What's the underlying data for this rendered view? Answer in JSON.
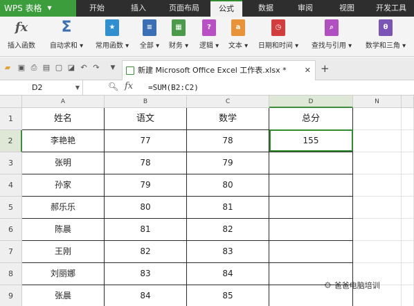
{
  "app": {
    "name": "WPS 表格"
  },
  "menu": {
    "tabs": [
      "开始",
      "插入",
      "页面布局",
      "公式",
      "数据",
      "审阅",
      "视图",
      "开发工具"
    ],
    "active_index": 3
  },
  "ribbon": {
    "buttons": [
      {
        "label": "插入函数",
        "icon": "fx-icon"
      },
      {
        "label": "自动求和",
        "icon": "sigma-icon"
      },
      {
        "label": "常用函数",
        "icon": "star-icon"
      },
      {
        "label": "全部",
        "icon": "list-icon"
      },
      {
        "label": "财务",
        "icon": "finance-icon"
      },
      {
        "label": "逻辑",
        "icon": "logic-icon"
      },
      {
        "label": "文本",
        "icon": "text-icon"
      },
      {
        "label": "日期和时间",
        "icon": "clock-icon"
      },
      {
        "label": "查找与引用",
        "icon": "search-icon"
      },
      {
        "label": "数学和三角",
        "icon": "theta-icon"
      }
    ],
    "colors": {
      "star": "#2f8fcf",
      "list": "#3a6fb5",
      "finance": "#4a9a4a",
      "logic": "#b84fc4",
      "text": "#e8923a",
      "clock": "#d23c3c",
      "search": "#b04fbf",
      "theta": "#7a55b5"
    }
  },
  "document": {
    "tab_title": "新建 Microsoft Office Excel 工作表.xlsx *"
  },
  "formula_bar": {
    "cell_ref": "D2",
    "formula": "=SUM(B2:C2)"
  },
  "sheet": {
    "columns": [
      "A",
      "B",
      "C",
      "D",
      "N"
    ],
    "selected_column": "D",
    "row_numbers": [
      "1",
      "2",
      "3",
      "4",
      "5",
      "6",
      "7",
      "8",
      "9"
    ],
    "selected_row": "2",
    "header": [
      "姓名",
      "语文",
      "数学",
      "总分"
    ],
    "rows": [
      [
        "李艳艳",
        "77",
        "78",
        "155"
      ],
      [
        "张明",
        "78",
        "79",
        ""
      ],
      [
        "孙家",
        "79",
        "80",
        ""
      ],
      [
        "郝乐乐",
        "80",
        "81",
        ""
      ],
      [
        "陈晨",
        "81",
        "82",
        ""
      ],
      [
        "王刚",
        "82",
        "83",
        ""
      ],
      [
        "刘丽娜",
        "83",
        "84",
        ""
      ],
      [
        "张晨",
        "84",
        "85",
        ""
      ]
    ]
  },
  "watermark": {
    "text": "爸爸电脑培训"
  },
  "colors": {
    "accent": "#2e8b2e",
    "menubar": "#2e2e2e",
    "app_button": "#3c9d3c"
  }
}
